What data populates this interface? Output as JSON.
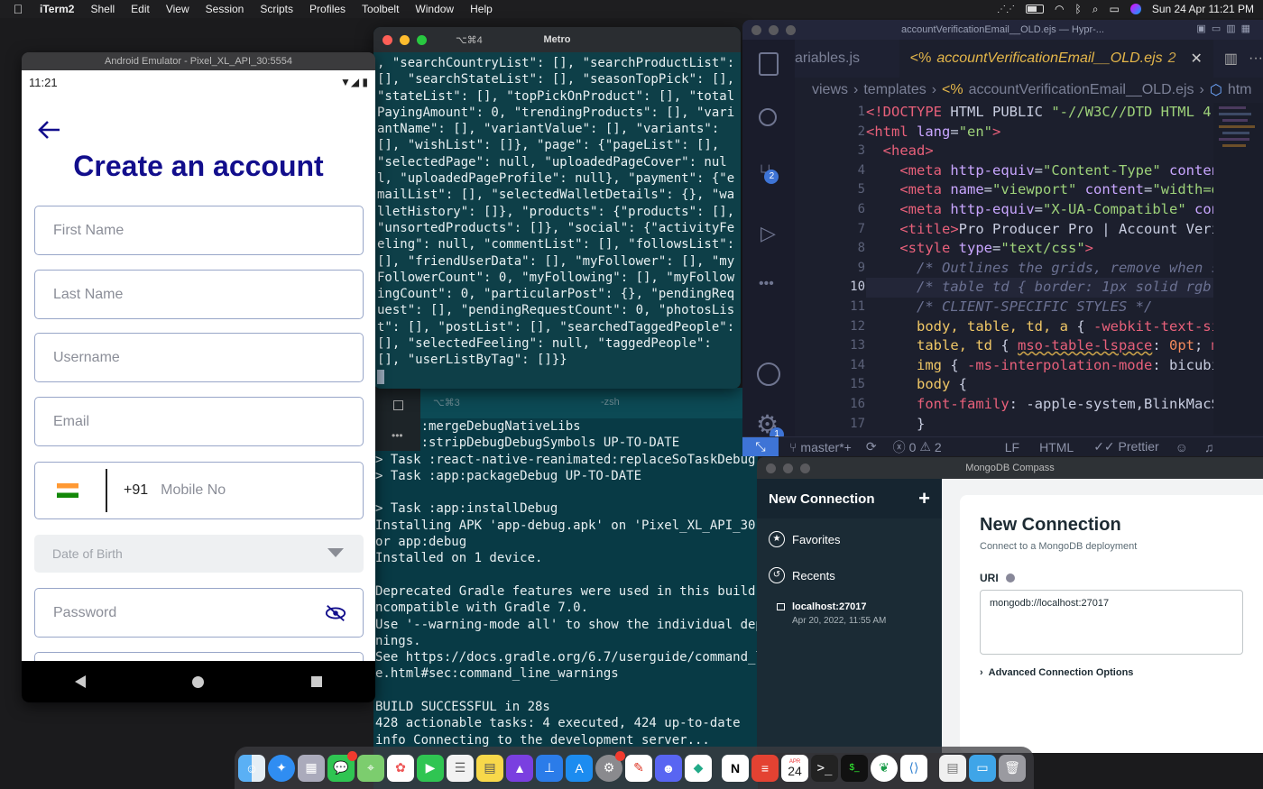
{
  "menubar": {
    "app": "iTerm2",
    "items": [
      "Shell",
      "Edit",
      "View",
      "Session",
      "Scripts",
      "Profiles",
      "Toolbelt",
      "Window",
      "Help"
    ],
    "datetime": "Sun 24 Apr  11:21 PM"
  },
  "metro": {
    "shortcut": "⌥⌘4",
    "title": "Metro",
    "text": ", \"searchCountryList\": [], \"searchProductList\": [], \"searchStateList\": [], \"seasonTopPick\": [], \"stateList\": [], \"topPickOnProduct\": [], \"totalPayingAmount\": 0, \"trendingProducts\": [], \"variantName\": [], \"variantValue\": [], \"variants\": [], \"wishList\": []}, \"page\": {\"pageList\": [], \"selectedPage\": null, \"uploadedPageCover\": null, \"uploadedPageProfile\": null}, \"payment\": {\"emailList\": [], \"selectedWalletDetails\": {}, \"walletHistory\": []}, \"products\": {\"products\": [], \"unsortedProducts\": []}, \"social\": {\"activityFeeling\": null, \"commentList\": [], \"followsList\": [], \"friendUserData\": [], \"myFollower\": [], \"myFollowerCount\": 0, \"myFollowing\": [], \"myFollowingCount\": 0, \"particularPost\": {}, \"pendingRequest\": [], \"pendingRequestCount\": 0, \"photosList\": [], \"postList\": [], \"searchedTaggedPeople\": [], \"selectedFeeling\": null, \"taggedPeople\": [], \"userListByTag\": []}}"
  },
  "term": {
    "tab_shortcut": "⌥⌘3",
    "tab_title": "-zsh",
    "lines": [
      "  :app:mergeDebugNativeLibs",
      "  :app:stripDebugDebugSymbols UP-TO-DATE",
      "> Task :react-native-reanimated:replaceSoTaskDebug",
      "> Task :app:packageDebug UP-TO-DATE",
      "",
      "> Task :app:installDebug",
      "Installing APK 'app-debug.apk' on 'Pixel_XL_API_30(",
      "or app:debug",
      "Installed on 1 device.",
      "",
      "Deprecated Gradle features were used in this build,",
      "ncompatible with Gradle 7.0.",
      "Use '--warning-mode all' to show the individual dep",
      "nings.",
      "See https://docs.gradle.org/6.7/userguide/command_l",
      "e.html#sec:command_line_warnings",
      "",
      "BUILD SUCCESSFUL in 28s",
      "428 actionable tasks: 4 executed, 424 up-to-date",
      "info Connecting to the development server...",
      ""
    ]
  },
  "emulator": {
    "title": "Android Emulator - Pixel_XL_API_30:5554",
    "time": "11:21",
    "heading": "Create an account",
    "first_name": "First Name",
    "last_name": "Last Name",
    "username": "Username",
    "email": "Email",
    "country_code": "+91",
    "mobile": "Mobile No",
    "dob": "Date of Birth",
    "password": "Password"
  },
  "vscode": {
    "window_title": "accountVerificationEmail__OLD.ejs — Hypr-...",
    "tab_prev": "ariables.js",
    "tab_active": "accountVerificationEmail__OLD.ejs",
    "tab_active_count": "2",
    "breadcrumb": [
      "views",
      "templates",
      "accountVerificationEmail__OLD.ejs",
      "htm"
    ],
    "line_numbers": [
      "1",
      "2",
      "3",
      "4",
      "5",
      "6",
      "7",
      "8",
      "9",
      "10",
      "11",
      "12",
      "13",
      "14",
      "15",
      "16",
      "17"
    ],
    "branch": "master*+",
    "errors": "0",
    "warnings": "2",
    "eol": "LF",
    "lang": "HTML",
    "formatter": "Prettier",
    "scm_badge": "2",
    "settings_badge": "1"
  },
  "compass": {
    "title": "MongoDB Compass",
    "sidebar_title": "New Connection",
    "favorites": "Favorites",
    "recents": "Recents",
    "recent_host": "localhost:27017",
    "recent_time": "Apr 20, 2022, 11:55 AM",
    "heading": "New Connection",
    "subheading": "Connect to a MongoDB deployment",
    "uri_label": "URI",
    "uri_value": "mongodb://localhost:27017",
    "advanced": "Advanced Connection Options"
  },
  "dock": {
    "calendar_month": "APR",
    "calendar_day": "24"
  }
}
